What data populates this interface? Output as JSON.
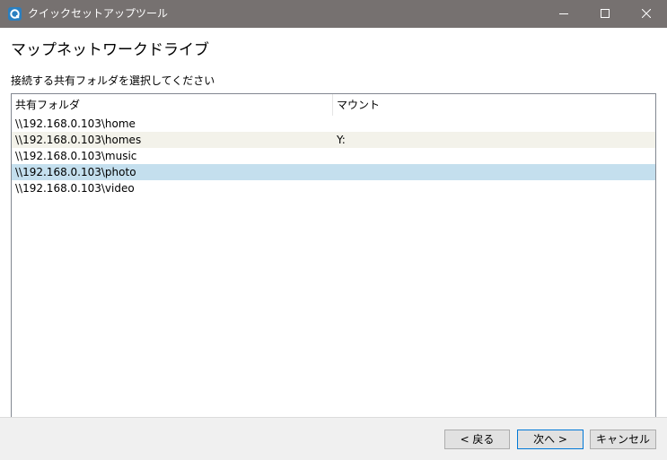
{
  "window": {
    "title": "クイックセットアップツール",
    "app_icon": "qnap-app-icon",
    "titlebar_color": "#767170"
  },
  "page": {
    "title": "マップネットワークドライブ",
    "instruction": "接続する共有フォルダを選択してください"
  },
  "list": {
    "columns": {
      "share": "共有フォルダ",
      "mount": "マウント"
    },
    "rows": [
      {
        "share": "\\\\192.168.0.103\\home",
        "mount": ""
      },
      {
        "share": "\\\\192.168.0.103\\homes",
        "mount": "Y:"
      },
      {
        "share": "\\\\192.168.0.103\\music",
        "mount": ""
      },
      {
        "share": "\\\\192.168.0.103\\photo",
        "mount": ""
      },
      {
        "share": "\\\\192.168.0.103\\video",
        "mount": ""
      }
    ],
    "selected_index": 3,
    "selected_color": "#c4dfee"
  },
  "buttons": {
    "back": "< 戻る",
    "next": "次へ >",
    "cancel": "キャンセル"
  }
}
